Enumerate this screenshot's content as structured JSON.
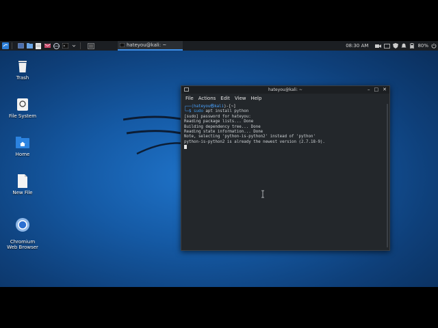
{
  "taskbar": {
    "active_window_label": "hateyou@kali: ~",
    "clock": "08:30 AM",
    "battery": "80%",
    "icons": [
      "kali-menu-icon",
      "show-desktop-icon",
      "file-manager-icon",
      "text-editor-icon",
      "mail-icon",
      "browser-icon",
      "terminal-icon",
      "dropdown-icon",
      "workspace-icon"
    ],
    "tray_icons": [
      "camera-icon",
      "screen-icon",
      "shield-icon",
      "bell-icon",
      "lock-icon",
      "battery-icon",
      "power-icon"
    ]
  },
  "desktop": {
    "icons": [
      {
        "label": "Trash",
        "icon": "trash-icon"
      },
      {
        "label": "File System",
        "icon": "drive-icon"
      },
      {
        "label": "Home",
        "icon": "home-folder-icon"
      },
      {
        "label": "New File",
        "icon": "file-icon"
      },
      {
        "label": "Chromium\nWeb Browser",
        "icon": "chromium-icon"
      }
    ]
  },
  "terminal": {
    "title": "hateyou@kali: ~",
    "menu": [
      "File",
      "Actions",
      "Edit",
      "View",
      "Help"
    ],
    "prompt": {
      "prefix_top": "┌──(",
      "user_host": "hateyou㉿kali",
      "path": ")-[~]",
      "prefix_bottom": "└─$ ",
      "sudo": "sudo",
      "command": " apt install python"
    },
    "output": [
      "[sudo] password for hateyou:",
      "Reading package lists... Done",
      "Building dependency tree... Done",
      "Reading state information... Done",
      "Note, selecting 'python-is-python2' instead of 'python'",
      "python-is-python2 is already the newest version (2.7.18-9)."
    ]
  },
  "colors": {
    "accent": "#3d8ee8",
    "panel": "#1b1e22",
    "terminal_bg": "#23272b"
  }
}
